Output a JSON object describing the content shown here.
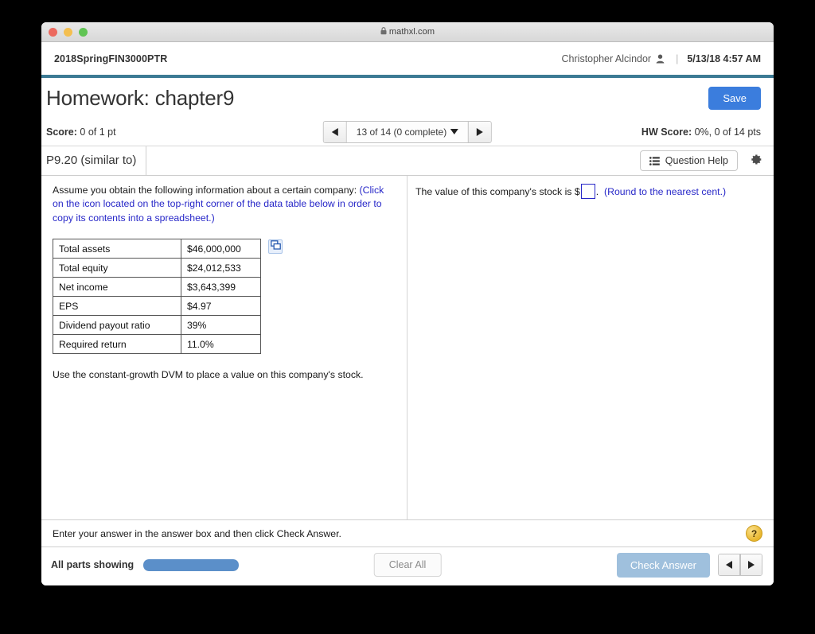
{
  "browser": {
    "url": "mathxl.com",
    "lock_icon": "lock-icon",
    "traffic_lights": [
      "close-red",
      "minimize-yellow",
      "zoom-green"
    ]
  },
  "top_nav": {
    "course_id": "2018SpringFIN3000PTR",
    "user_name": "Christopher Alcindor",
    "person_icon": "person-icon",
    "separator": "|",
    "datetime": "5/13/18 4:57 AM"
  },
  "title_bar": {
    "title": "Homework: chapter9",
    "save_label": "Save"
  },
  "score_bar": {
    "score_label": "Score:",
    "score_value": "0 of 1 pt",
    "pager_label": "13 of 14 (0 complete)",
    "hw_score_label": "HW Score:",
    "hw_score_value": "0%, 0 of 14 pts"
  },
  "question_header": {
    "tab_label": "P9.20 (similar to)",
    "question_help_label": "Question Help",
    "gear_icon": "gear-icon"
  },
  "question": {
    "prompt_black": "Assume you obtain the following information about a certain company:",
    "prompt_blue": "(Click on the icon located on the top-right corner of the data table below in order to copy its contents into a spreadsheet.)",
    "copy_icon": "copy-to-spreadsheet-icon",
    "table": [
      {
        "label": "Total assets",
        "value": "$46,000,000"
      },
      {
        "label": "Total equity",
        "value": "$24,012,533"
      },
      {
        "label": "Net income",
        "value": "$3,643,399"
      },
      {
        "label": "EPS",
        "value": "$4.97"
      },
      {
        "label": "Dividend payout ratio",
        "value": "39%"
      },
      {
        "label": "Required return",
        "value": "11.0%"
      }
    ],
    "instruction": "Use the constant-growth DVM to place a value on this company's stock."
  },
  "answer_panel": {
    "prefix": "The value of this company's stock is $",
    "input_value": "",
    "suffix_period": ".",
    "hint": "(Round to the nearest cent.)"
  },
  "footer": {
    "message": "Enter your answer in the answer box and then click Check Answer.",
    "help_badge": "?",
    "parts_label": "All parts showing",
    "progress_percent": 100,
    "clear_all_label": "Clear All",
    "check_answer_label": "Check Answer"
  },
  "colors": {
    "accent_blue": "#3b7ddd",
    "teal_rule": "#3c7a94",
    "link_blue": "#2727c8",
    "progress_blue": "#5b8fc9",
    "check_answer_disabled": "#9fc0dd",
    "help_badge_gold": "#e8b62e"
  }
}
